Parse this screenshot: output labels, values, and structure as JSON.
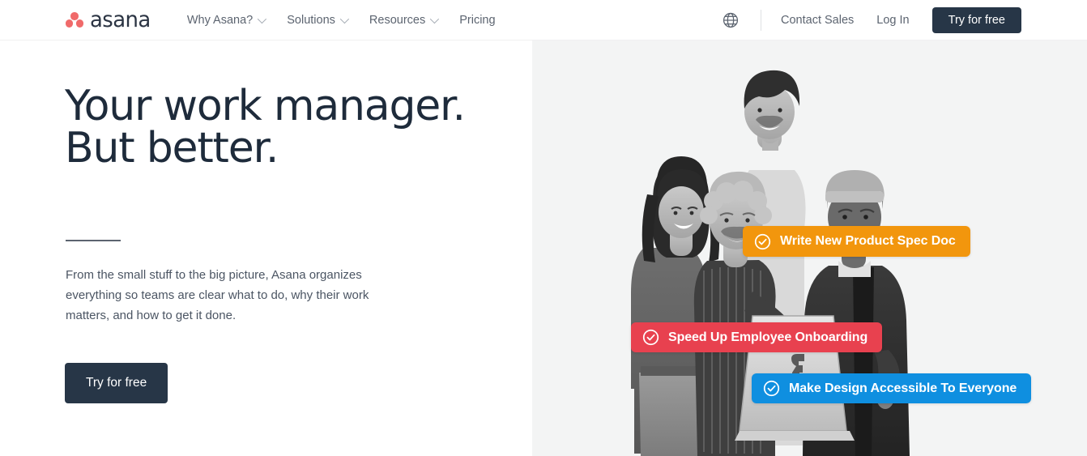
{
  "header": {
    "logo": {
      "name": "asana",
      "dot_color": "#f06a6a",
      "word_color": "#2b3443"
    },
    "nav": [
      {
        "label": "Why Asana?",
        "has_dropdown": true
      },
      {
        "label": "Solutions",
        "has_dropdown": true
      },
      {
        "label": "Resources",
        "has_dropdown": true
      },
      {
        "label": "Pricing",
        "has_dropdown": false
      }
    ],
    "language_icon": "globe-icon",
    "contact_sales": "Contact Sales",
    "log_in": "Log In",
    "try_free": "Try for free"
  },
  "hero": {
    "headline": "Your work manager.\nBut better.",
    "body": "From the small stuff to the big picture, Asana organizes everything so teams are clear what to do, why their work matters, and how to get it done.",
    "cta": "Try for free",
    "background": "#f3f4f4",
    "image_alt": "Four colleagues smiling around an open laptop",
    "pills": [
      {
        "label": "Write New Product Spec Doc",
        "color": "#f2960d",
        "icon": "check-circle-icon"
      },
      {
        "label": "Speed Up Employee Onboarding",
        "color": "#e8414f",
        "icon": "check-circle-icon"
      },
      {
        "label": "Make Design Accessible To Everyone",
        "color": "#0f8fe0",
        "icon": "check-circle-icon"
      }
    ]
  }
}
